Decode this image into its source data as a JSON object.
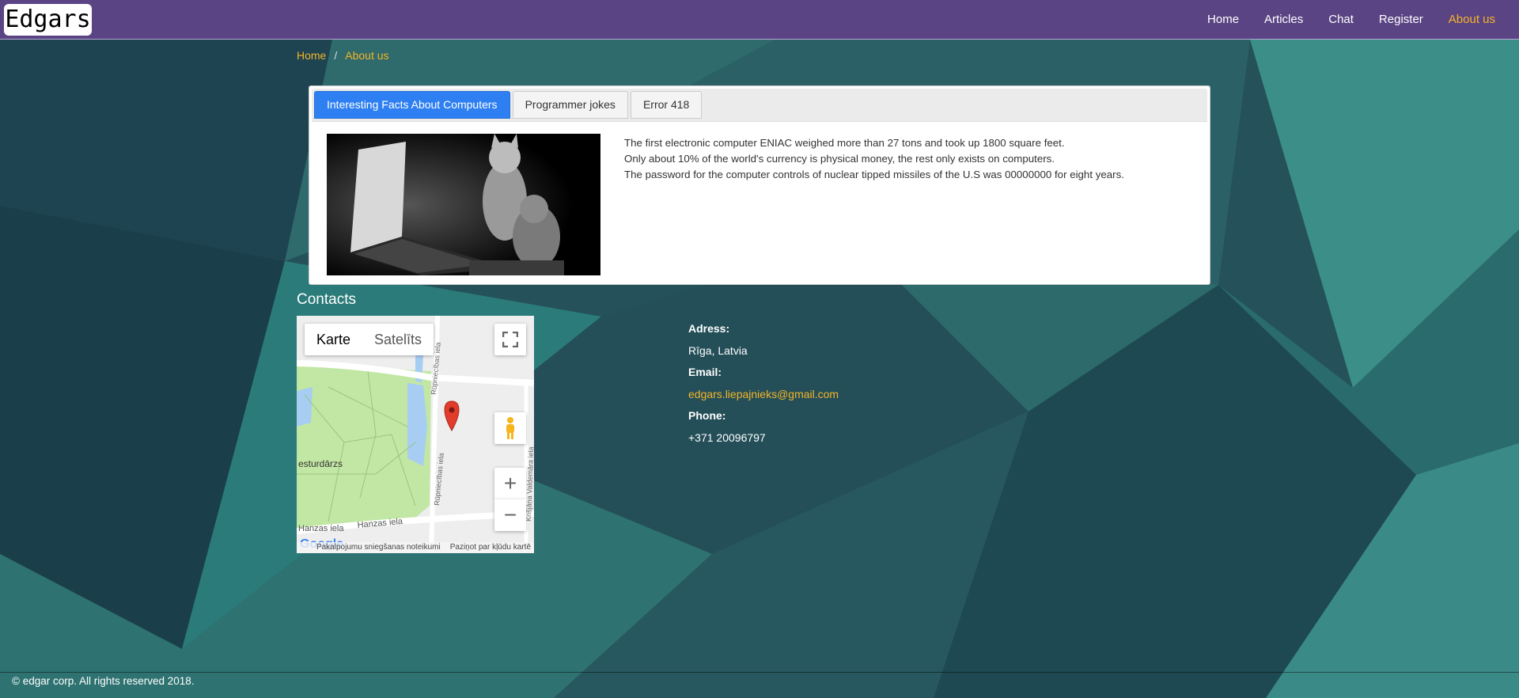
{
  "brand": "Edgars",
  "nav": {
    "home": "Home",
    "articles": "Articles",
    "chat": "Chat",
    "register": "Register",
    "about": "About us"
  },
  "breadcrumb": {
    "home": "Home",
    "separator": "/",
    "current": "About us"
  },
  "tabs": {
    "facts": "Interesting Facts About Computers",
    "jokes": "Programmer jokes",
    "error": "Error 418"
  },
  "facts": [
    "The first electronic computer ENIAC weighed more than 27 tons and took up 1800 square feet.",
    "Only about 10% of the world's currency is physical money, the rest only exists on computers.",
    "The password for the computer controls of nuclear tipped missiles of the U.S was 00000000 for eight years."
  ],
  "contacts": {
    "title": "Contacts",
    "address_label": "Adress:",
    "address": "Rīga, Latvia",
    "email_label": "Email:",
    "email": "edgars.liepajnieks@gmail.com",
    "phone_label": "Phone:",
    "phone": "+371 20096797"
  },
  "map": {
    "type_map": "Karte",
    "type_satellite": "Satelīts",
    "zoom_in": "+",
    "zoom_out": "−",
    "street_1": "Rūpniecības iela",
    "street_2": "Hanzas iela",
    "street_3": "Hanzas iela",
    "street_4": "Rūpniecības iela",
    "street_5": "Krišjāņa Valdemāra iela",
    "park": "esturdārzs",
    "google": "Google",
    "terms": "Pakalpojumu sniegšanas noteikumi",
    "report": "Paziņot par kļūdu kartē"
  },
  "footer": "© edgar corp. All rights reserved 2018.",
  "colors": {
    "navbar": "#5b4484",
    "accent": "#f5b428",
    "tab_active": "#2d7ff2"
  }
}
